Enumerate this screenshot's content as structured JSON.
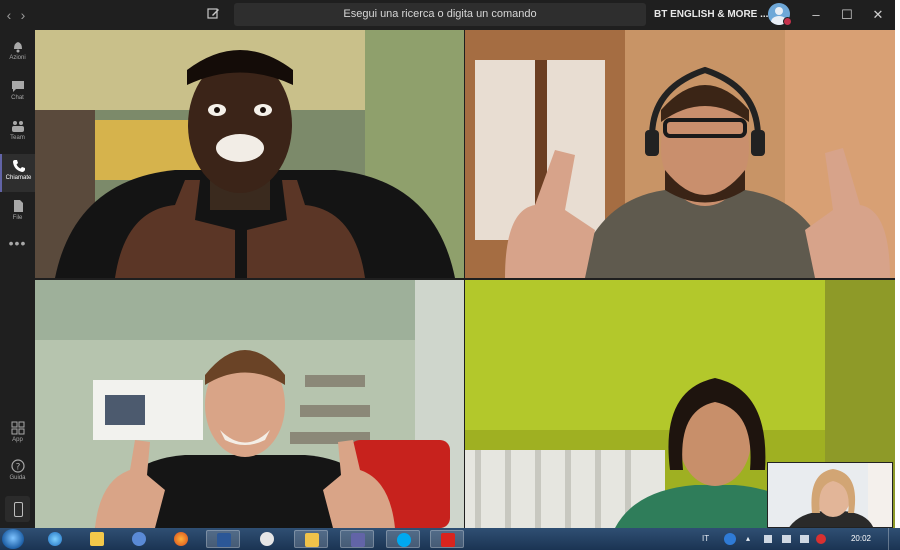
{
  "titlebar": {
    "back_glyph": "‹",
    "forward_glyph": "›",
    "compose_icon": "compose-icon",
    "search_placeholder": "Esegui una ricerca o digita un comando",
    "team_name": "BT ENGLISH & MORE ...",
    "presence_color": "#c4314b",
    "minimize_glyph": "–",
    "maximize_glyph": "☐",
    "close_glyph": "✕"
  },
  "rail": {
    "items": [
      {
        "label": "Azioni",
        "icon": "bell-icon"
      },
      {
        "label": "Chat",
        "icon": "chat-icon"
      },
      {
        "label": "Team",
        "icon": "teams-icon"
      },
      {
        "label": "Chiamate",
        "icon": "phone-icon"
      },
      {
        "label": "File",
        "icon": "file-icon"
      }
    ],
    "more_glyph": "•••",
    "bottom_items": [
      {
        "label": "App",
        "icon": "apps-icon"
      },
      {
        "label": "Guida",
        "icon": "help-icon"
      }
    ],
    "active_label": "Chiamate",
    "accent_color": "#6264a7"
  },
  "taskbar": {
    "language": "IT",
    "time": "20:02",
    "apps": [
      "ie-icon",
      "folder-icon",
      "media-player-icon",
      "firefox-icon",
      "word-icon",
      "paint-icon",
      "mail-icon",
      "teams-icon",
      "skype-icon",
      "acrobat-icon"
    ]
  }
}
